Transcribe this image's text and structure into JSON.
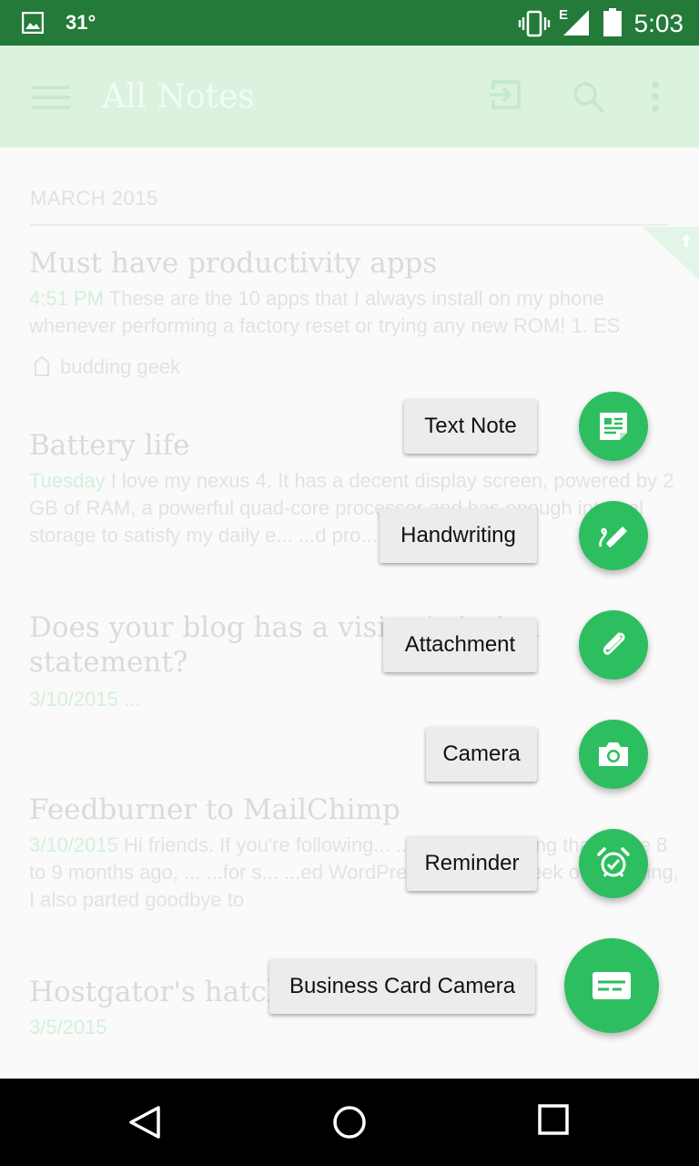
{
  "status_bar": {
    "temperature": "31°",
    "time": "5:03",
    "network": "E"
  },
  "app_bar": {
    "title": "All Notes"
  },
  "section_header": "MARCH 2015",
  "notes": [
    {
      "title": "Must have productivity apps",
      "date": "4:51 PM",
      "snippet": " These are the 10 apps that I always install on my phone whenever performing a factory reset or trying any new ROM! 1. ES",
      "tag": "budding geek"
    },
    {
      "title": "Battery life",
      "date": "Tuesday",
      "snippet": " I love my nexus 4. It has a decent display screen, powered by 2 GB of RAM, a powerful quad-core processor and has enough internal storage to satisfy my daily e... ...d pro... ...ty"
    },
    {
      "title": "Does your blog has a vision/mission statement?",
      "date": "3/10/2015",
      "snippet": " ..."
    },
    {
      "title": "Feedburner to MailChimp",
      "date": "3/10/2015",
      "snippet": " Hi friends. If you're following... ...might... knowing that some 8 to 9 months ago, ... ...for s... ...ed WordPress. Within a week of migrating, I also parted goodbye to"
    },
    {
      "title": "Hostgator's hatch...",
      "date": "3/5/2015",
      "snippet": ""
    }
  ],
  "fab_menu": [
    {
      "label": "Text Note",
      "icon": "text-note-icon"
    },
    {
      "label": "Handwriting",
      "icon": "handwriting-icon"
    },
    {
      "label": "Attachment",
      "icon": "paperclip-icon"
    },
    {
      "label": "Camera",
      "icon": "camera-icon"
    },
    {
      "label": "Reminder",
      "icon": "alarm-clock-icon"
    },
    {
      "label": "Business Card Camera",
      "icon": "business-card-icon"
    }
  ],
  "colors": {
    "accent": "#2dbe60",
    "status_bar": "#237a39",
    "app_bar": "#dbf2df"
  }
}
